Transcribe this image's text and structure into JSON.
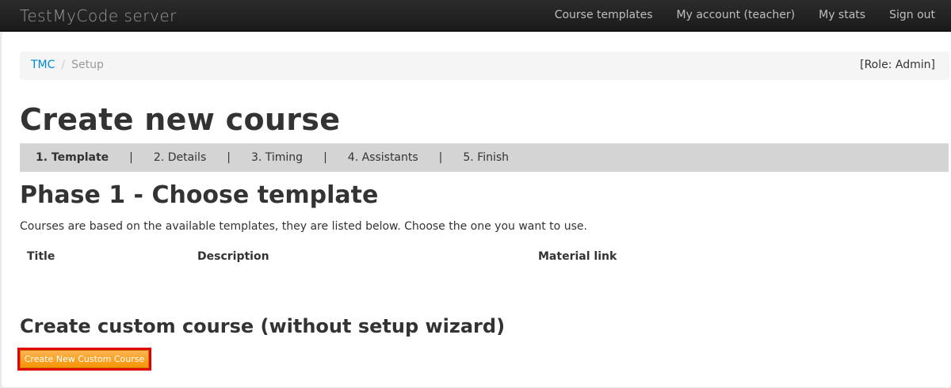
{
  "navbar": {
    "brand": "TestMyCode server",
    "links": [
      "Course templates",
      "My account (teacher)",
      "My stats",
      "Sign out"
    ]
  },
  "breadcrumb": {
    "home": "TMC",
    "separator": "/",
    "current": "Setup",
    "role": "[Role: Admin]"
  },
  "page_title": "Create new course",
  "steps": {
    "items": [
      "1. Template",
      "2. Details",
      "3. Timing",
      "4. Assistants",
      "5. Finish"
    ],
    "separator": "|",
    "current_index": 0
  },
  "phase": {
    "title": "Phase 1 - Choose template",
    "intro": "Courses are based on the available templates, they are listed below. Choose the one you want to use."
  },
  "templates_table": {
    "columns": [
      "Title",
      "Description",
      "Material link"
    ],
    "rows": []
  },
  "custom": {
    "title": "Create custom course (without setup wizard)",
    "button_label": "Create New Custom Course"
  },
  "colors": {
    "link": "#0088cc",
    "button": "#f89406",
    "highlight": "#e00000"
  }
}
